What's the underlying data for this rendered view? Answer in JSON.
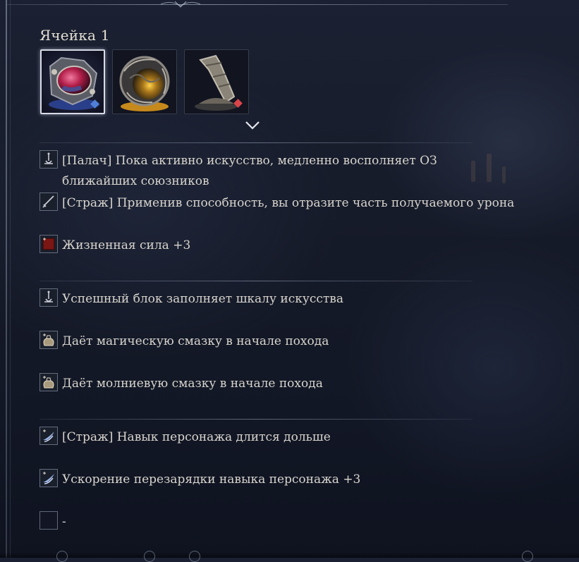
{
  "slot": {
    "title": "Ячейка 1"
  },
  "relics": [
    {
      "icon": "red-gem-relic-icon",
      "selected": true,
      "tier_color": "#4f7fd6"
    },
    {
      "icon": "golden-orb-relic-icon",
      "selected": false,
      "tier_color": "#d9a63a"
    },
    {
      "icon": "stone-pillar-relic-icon",
      "selected": false,
      "tier_color": "#d9454a"
    }
  ],
  "groups": [
    [
      {
        "icon": "executor-icon",
        "text": "[Палач] Пока активно искусство, медленно восполняет ОЗ",
        "text2": "ближайших союзников"
      },
      {
        "icon": "sword-icon",
        "text": "[Страж] Применив способность, вы отразите часть получаемого урона"
      },
      {
        "icon": "vigor-icon",
        "text": "Жизненная сила +3"
      }
    ],
    [
      {
        "icon": "executor-icon",
        "text": "Успешный блок заполняет шкалу искусства"
      },
      {
        "icon": "pouch-icon",
        "text": "Даёт магическую смазку в начале похода"
      },
      {
        "icon": "pouch-icon",
        "text": "Даёт молниевую смазку в начале похода"
      }
    ],
    [
      {
        "icon": "skill-wing-icon",
        "text": "[Страж] Навык персонажа длится дольше"
      },
      {
        "icon": "skill-wing-icon",
        "text": "Ускорение перезарядки навыка персонажа +3"
      },
      {
        "icon": "empty-slot-icon",
        "text": "-"
      }
    ]
  ]
}
